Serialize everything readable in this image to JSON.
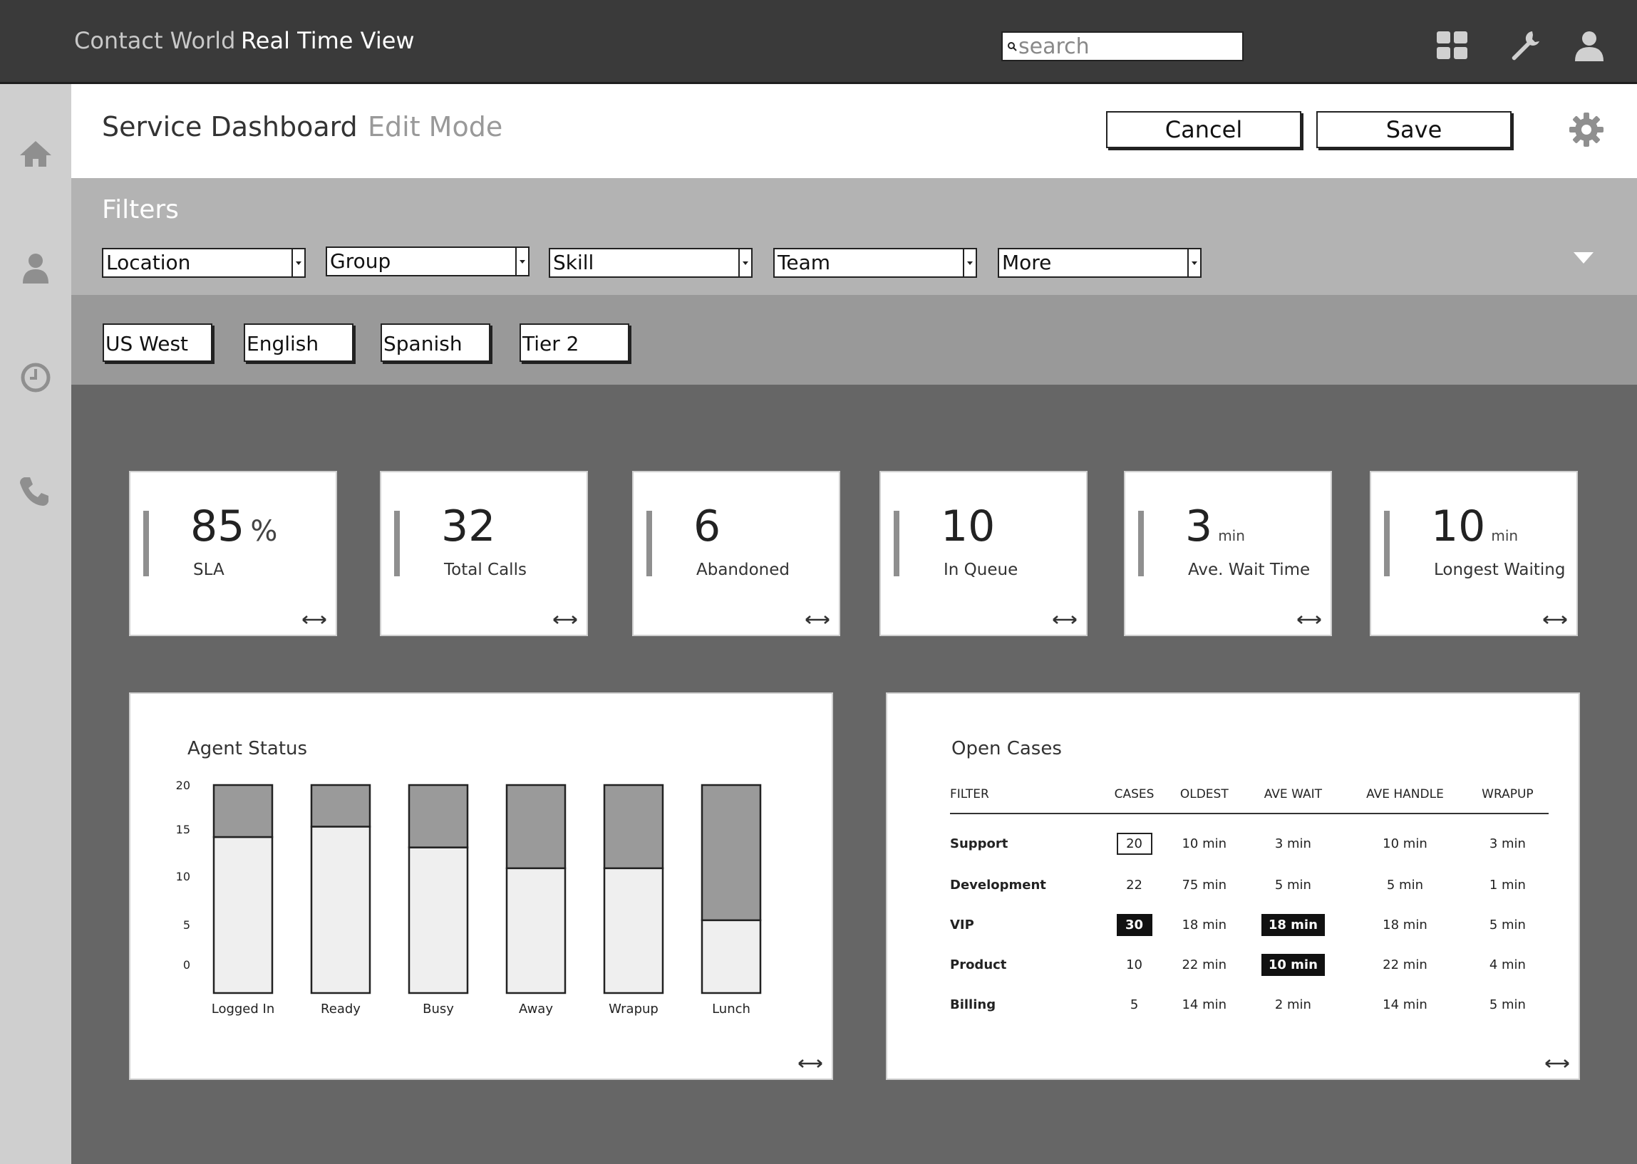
{
  "topbar": {
    "app_title": "Contact World",
    "view_title": "Real Time View",
    "search_placeholder": "search",
    "icons": [
      "grid-icon",
      "wrench-icon",
      "user-icon"
    ]
  },
  "leftnav": {
    "icons": [
      "home-icon",
      "person-icon",
      "clock-icon",
      "phone-icon"
    ]
  },
  "header": {
    "title": "Service Dashboard",
    "mode": "Edit Mode",
    "cancel_label": "Cancel",
    "save_label": "Save"
  },
  "filters": {
    "title": "Filters",
    "dropdowns": [
      "Location",
      "Group",
      "Skill",
      "Team",
      "More"
    ]
  },
  "chips": [
    "US West",
    "English",
    "Spanish",
    "Tier 2"
  ],
  "kpis": [
    {
      "value": "85",
      "unit": "%",
      "label": "SLA"
    },
    {
      "value": "32",
      "unit": "",
      "label": "Total Calls"
    },
    {
      "value": "6",
      "unit": "",
      "label": "Abandoned"
    },
    {
      "value": "10",
      "unit": "",
      "label": "In Queue"
    },
    {
      "value": "3",
      "unit": "min",
      "label": "Ave. Wait Time"
    },
    {
      "value": "10",
      "unit": "min",
      "label": "Longest Waiting"
    }
  ],
  "agent_status": {
    "title": "Agent Status"
  },
  "chart_data": {
    "type": "bar",
    "title": "Agent Status",
    "categories": [
      "Logged In",
      "Ready",
      "Busy",
      "Away",
      "Wrapup",
      "Lunch"
    ],
    "y_ticks": [
      "20",
      "15",
      "10",
      "5",
      "0"
    ],
    "series": [
      {
        "values": [
          15,
          16,
          14,
          12,
          12,
          7
        ]
      },
      {
        "values": [
          5,
          4,
          6,
          8,
          8,
          13
        ]
      }
    ],
    "colors": [
      "#efefef",
      "#9a9a9a"
    ],
    "stacked": true,
    "grid": false
  },
  "open_cases": {
    "title": "Open Cases",
    "columns": [
      "FILTER",
      "CASES",
      "OLDEST",
      "AVE WAIT",
      "AVE HANDLE",
      "WRAPUP"
    ],
    "rows": [
      [
        "Support",
        "20",
        "10 min",
        "3 min",
        "10 min",
        "3 min"
      ],
      [
        "Development",
        "22",
        "75 min",
        "5 min",
        "5 min",
        "1 min"
      ],
      [
        "VIP",
        "30",
        "18 min",
        "18 min",
        "18 min",
        "5 min"
      ],
      [
        "Product",
        "10",
        "22 min",
        "10 min",
        "22 min",
        "4 min"
      ],
      [
        "Billing",
        "5",
        "14 min",
        "2 min",
        "14 min",
        "5 min"
      ]
    ]
  }
}
